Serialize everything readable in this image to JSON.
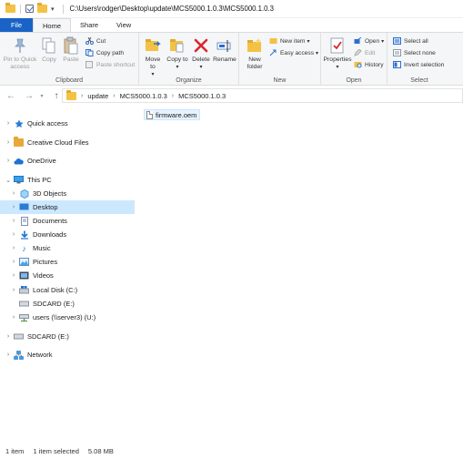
{
  "window": {
    "title_path": "C:\\Users\\rodger\\Desktop\\update\\MCS5000.1.0.3\\MCS5000.1.0.3"
  },
  "tabs": [
    "File",
    "Home",
    "Share",
    "View"
  ],
  "ribbon": {
    "clipboard": {
      "label": "Clipboard",
      "pin": "Pin to Quick access",
      "copy": "Copy",
      "paste": "Paste",
      "cut": "Cut",
      "copy_path": "Copy path",
      "paste_shortcut": "Paste shortcut"
    },
    "organize": {
      "label": "Organize",
      "move_to": "Move to",
      "copy_to": "Copy to",
      "delete": "Delete",
      "rename": "Rename"
    },
    "new": {
      "label": "New",
      "new_folder": "New folder",
      "new_item": "New item",
      "easy_access": "Easy access"
    },
    "open": {
      "label": "Open",
      "properties": "Properties",
      "open": "Open",
      "edit": "Edit",
      "history": "History"
    },
    "select": {
      "label": "Select",
      "select_all": "Select all",
      "select_none": "Select none",
      "invert_selection": "Invert selection"
    }
  },
  "address": {
    "crumbs": [
      "update",
      "MCS5000.1.0.3",
      "MCS5000.1.0.3"
    ]
  },
  "nav": {
    "quick_access": "Quick access",
    "creative_cloud": "Creative Cloud Files",
    "onedrive": "OneDrive",
    "this_pc": "This PC",
    "objects3d": "3D Objects",
    "desktop": "Desktop",
    "documents": "Documents",
    "downloads": "Downloads",
    "music": "Music",
    "pictures": "Pictures",
    "videos": "Videos",
    "local_disk": "Local Disk (C:)",
    "sdcard_sub": "SDCARD (E:)",
    "users_share": "users (\\\\server3) (U:)",
    "sdcard": "SDCARD (E:)",
    "network": "Network"
  },
  "content": {
    "files": [
      "firmware.oem"
    ]
  },
  "status": {
    "item_count": "1 item",
    "selected": "1 item selected",
    "size": "5.08 MB"
  },
  "colors": {
    "accent": "#1a63c6",
    "selection": "#cce8ff",
    "folder": "#f3c244"
  }
}
